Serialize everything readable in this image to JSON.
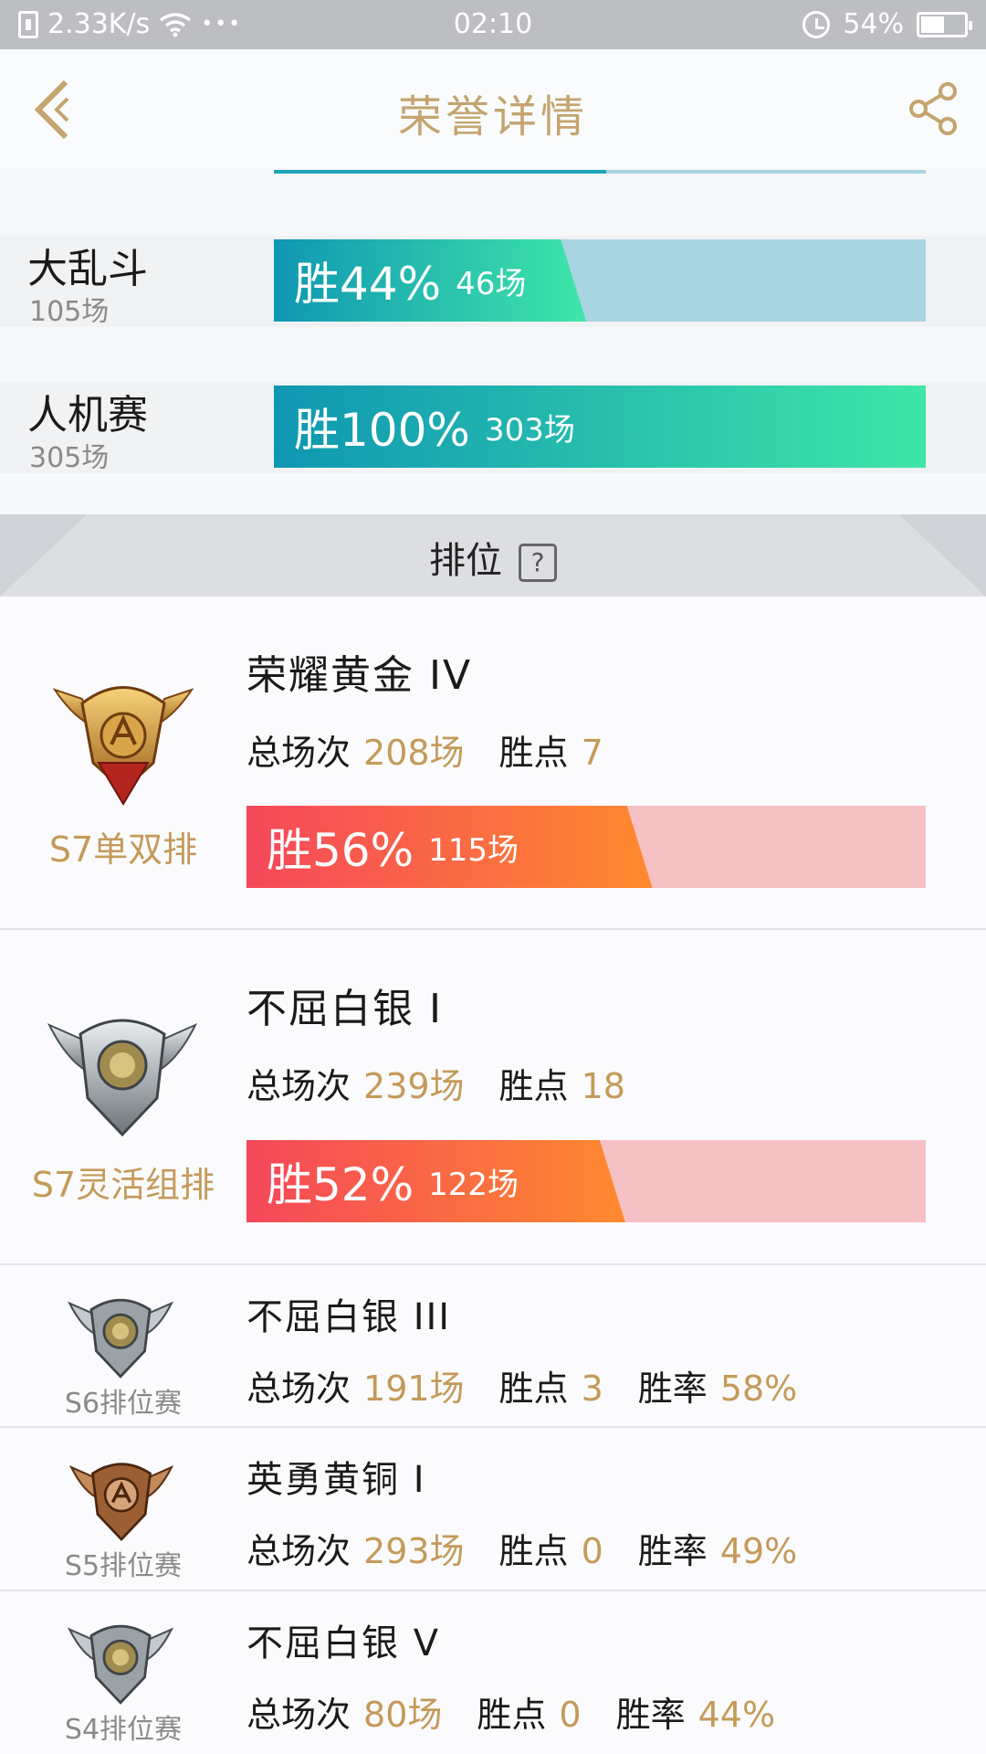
{
  "status_bar": {
    "speed": "2.33K/s",
    "dots": "•••",
    "time": "02:10",
    "battery": "54%",
    "battery_level": 0.54
  },
  "header": {
    "title": "荣誉详情"
  },
  "modes": [
    {
      "name": "大乱斗",
      "total": "105场",
      "win_label": "胜44%",
      "win_games": "46场",
      "win_rate": 0.44
    },
    {
      "name": "人机赛",
      "total": "305场",
      "win_label": "胜100%",
      "win_games": "303场",
      "win_rate": 1.0
    }
  ],
  "ranked_section": {
    "label": "排位",
    "help": "?"
  },
  "ranked": [
    {
      "season": "S7单双排",
      "tier": "荣耀黄金 IV",
      "total_label": "总场次",
      "total": "208场",
      "points_label": "胜点",
      "points": "7",
      "win_label": "胜56%",
      "win_games": "115场",
      "win_rate": 0.56,
      "badge": "gold-badge-icon"
    },
    {
      "season": "S7灵活组排",
      "tier": "不屈白银 I",
      "total_label": "总场次",
      "total": "239场",
      "points_label": "胜点",
      "points": "18",
      "win_label": "胜52%",
      "win_games": "122场",
      "win_rate": 0.52,
      "badge": "silver-badge-icon"
    }
  ],
  "history": [
    {
      "season": "S6排位赛",
      "tier": "不屈白银 III",
      "total_label": "总场次",
      "total": "191场",
      "points_label": "胜点",
      "points": "3",
      "rate_label": "胜率",
      "rate": "58%",
      "badge": "silver-badge-icon"
    },
    {
      "season": "S5排位赛",
      "tier": "英勇黄铜 I",
      "total_label": "总场次",
      "total": "293场",
      "points_label": "胜点",
      "points": "0",
      "rate_label": "胜率",
      "rate": "49%",
      "badge": "bronze-badge-icon"
    },
    {
      "season": "S4排位赛",
      "tier": "不屈白银 V",
      "total_label": "总场次",
      "total": "80场",
      "points_label": "胜点",
      "points": "0",
      "rate_label": "胜率",
      "rate": "44%",
      "badge": "silver-badge-icon"
    }
  ],
  "colors": {
    "accent": "#c4a46f",
    "value": "#c49a5a",
    "mode_fill_start": "#0f97b2",
    "mode_fill_end": "#3fe6a8",
    "mode_track": "#a9d4e1",
    "rank_fill_start": "#f5475b",
    "rank_fill_end": "#ff8a2e",
    "rank_track": "#f6c1c5"
  }
}
